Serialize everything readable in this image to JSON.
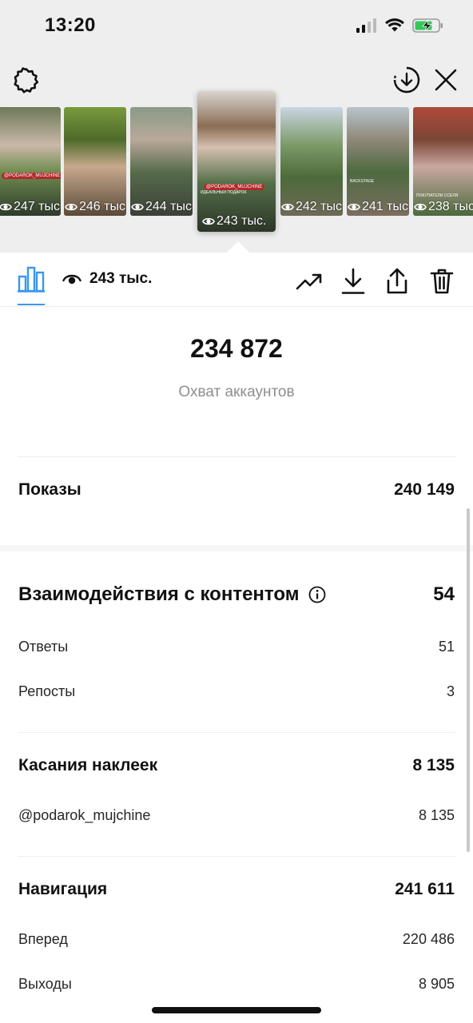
{
  "status_bar": {
    "time": "13:20"
  },
  "colors": {
    "accent": "#3897f0",
    "muted": "#8e8e8e",
    "tag_red": "#b02a2a"
  },
  "icons": {
    "settings": "gear-icon",
    "download_circle": "download-circle-icon",
    "close": "close-icon",
    "insights": "bar-chart-icon",
    "views": "eye-icon",
    "promote": "trend-up-icon",
    "download": "download-icon",
    "share": "share-icon",
    "delete": "trash-icon"
  },
  "stories": [
    {
      "views": "247 тыс.",
      "tag": "@PODAROK_MUJCHINE",
      "bg": "linear-gradient(180deg,#6d7a58 0%,#c9b8a8 35%,#6e8c4e 60%,#2f3a2c 100%)"
    },
    {
      "views": "246 тыс.",
      "tag": "",
      "bg": "linear-gradient(180deg,#7a9a3c 0%,#4e6b2a 30%,#c7a98d 55%,#5b4a3a 100%)"
    },
    {
      "views": "244 тыс.",
      "tag": "",
      "bg": "linear-gradient(180deg,#8a9a86 0%,#b9a99a 30%,#566b4a 60%,#3b4038 100%)"
    },
    {
      "views": "243 тыс.",
      "tag": "@PODAROK_MUJCHINE",
      "caption": "ИДЕАЛЬНЫЙ ПОДАРОК",
      "selected": true,
      "bg": "linear-gradient(180deg,#d8d4cf 0%,#8c6d55 25%,#d6c0b0 40%,#55704a 65%,#2c3528 100%)"
    },
    {
      "views": "242 тыс.",
      "tag": "",
      "bg": "linear-gradient(180deg,#c9d6e2 0%,#7c9a68 35%,#4d6a3a 65%,#6f6a58 100%)"
    },
    {
      "views": "241 тыс.",
      "tag": "",
      "caption": "BACKSTAGE",
      "bg": "linear-gradient(180deg,#b8c4cc 0%,#8f8878 30%,#4d6a40 60%,#7b6e60 100%)"
    },
    {
      "views": "238 тыс.",
      "tag": "",
      "caption": "ПОКУПАТЕЛИ ССЕЛЯ",
      "bg": "linear-gradient(180deg,#b04a3a 0%,#7a4536 30%,#c9a8a0 55%,#4a6a3c 100%)"
    }
  ],
  "action_bar": {
    "views": "243 тыс."
  },
  "summary": {
    "reach_value": "234 872",
    "reach_label": "Охват аккаунтов"
  },
  "impressions": {
    "label": "Показы",
    "value": "240 149"
  },
  "interactions": {
    "label": "Взаимодействия с контентом",
    "value": "54",
    "rows": [
      {
        "label": "Ответы",
        "value": "51"
      },
      {
        "label": "Репосты",
        "value": "3"
      }
    ]
  },
  "sticker_taps": {
    "label": "Касания наклеек",
    "value": "8 135",
    "rows": [
      {
        "label": "@podarok_mujchine",
        "value": "8 135"
      }
    ]
  },
  "navigation": {
    "label": "Навигация",
    "value": "241 611",
    "rows": [
      {
        "label": "Вперед",
        "value": "220 486"
      },
      {
        "label": "Выходы",
        "value": "8 905"
      }
    ]
  }
}
